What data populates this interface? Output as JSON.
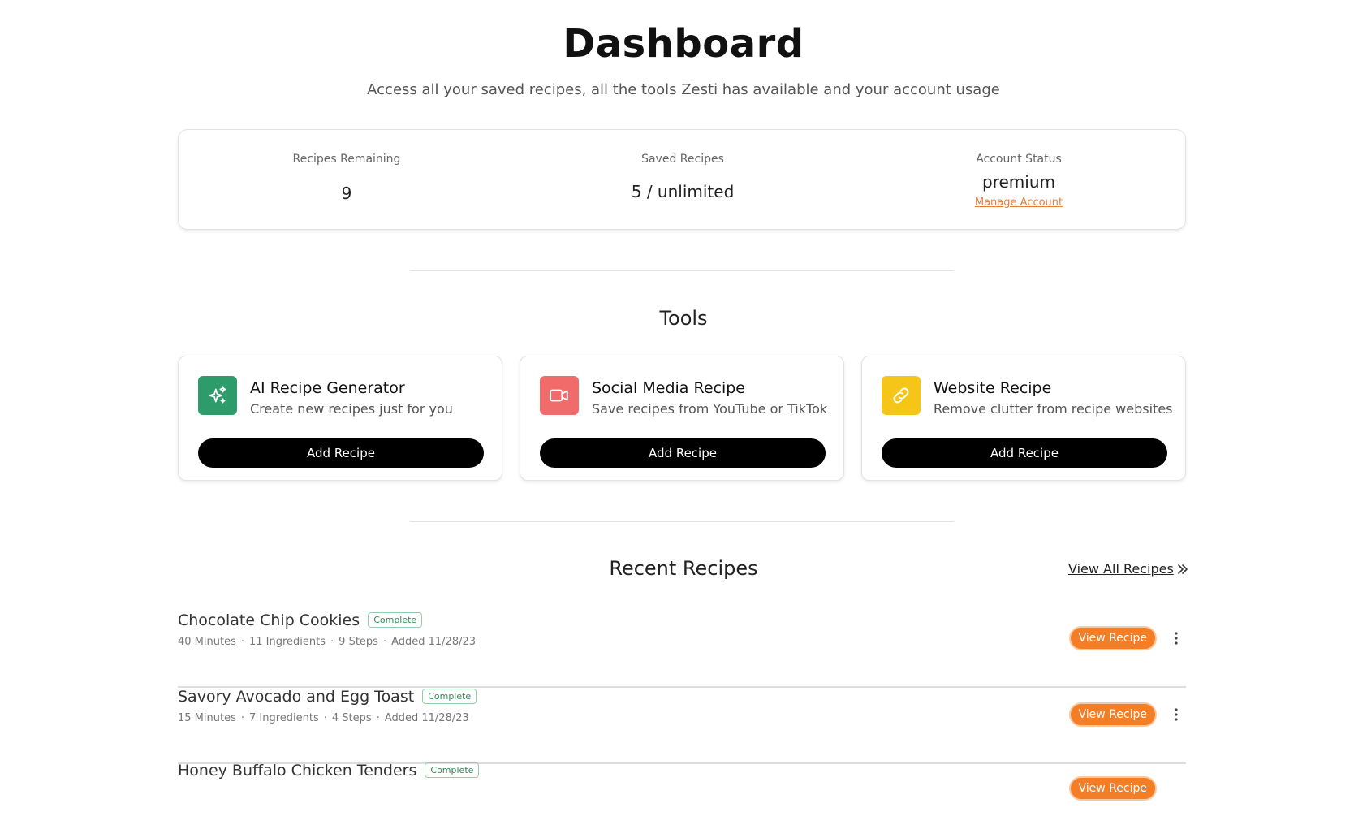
{
  "header": {
    "title": "Dashboard",
    "subtitle": "Access all your saved recipes, all the tools Zesti has available and your account usage"
  },
  "stats": {
    "remaining_label": "Recipes Remaining",
    "remaining_value": "9",
    "saved_label": "Saved Recipes",
    "saved_value": "5 / unlimited",
    "status_label": "Account Status",
    "status_value": "premium",
    "manage_link": "Manage Account",
    "link_color": "#e67e3a"
  },
  "tools": {
    "title": "Tools",
    "items": [
      {
        "title": "AI Recipe Generator",
        "desc": "Create new recipes just for you",
        "button": "Add Recipe",
        "icon": "sparkles-icon",
        "color": "#2e9b6b"
      },
      {
        "title": "Social Media Recipe",
        "desc": "Save recipes from YouTube or TikTok",
        "button": "Add Recipe",
        "icon": "video-icon",
        "color": "#f26b6b"
      },
      {
        "title": "Website Recipe",
        "desc": "Remove clutter from recipe websites",
        "button": "Add Recipe",
        "icon": "link-icon",
        "color": "#f5c518"
      }
    ]
  },
  "recent": {
    "title": "Recent Recipes",
    "view_all": "View All Recipes",
    "items": [
      {
        "name": "Chocolate Chip Cookies",
        "badge": "Complete",
        "time": "40 Minutes",
        "ingredients": "11 Ingredients",
        "steps": "9 Steps",
        "added": "Added 11/28/23",
        "button": "View Recipe"
      },
      {
        "name": "Savory Avocado and Egg Toast",
        "badge": "Complete",
        "time": "15 Minutes",
        "ingredients": "7 Ingredients",
        "steps": "4 Steps",
        "added": "Added 11/28/23",
        "button": "View Recipe"
      },
      {
        "name": "Honey Buffalo Chicken Tenders",
        "badge": "Complete",
        "button": "View Recipe"
      }
    ]
  }
}
